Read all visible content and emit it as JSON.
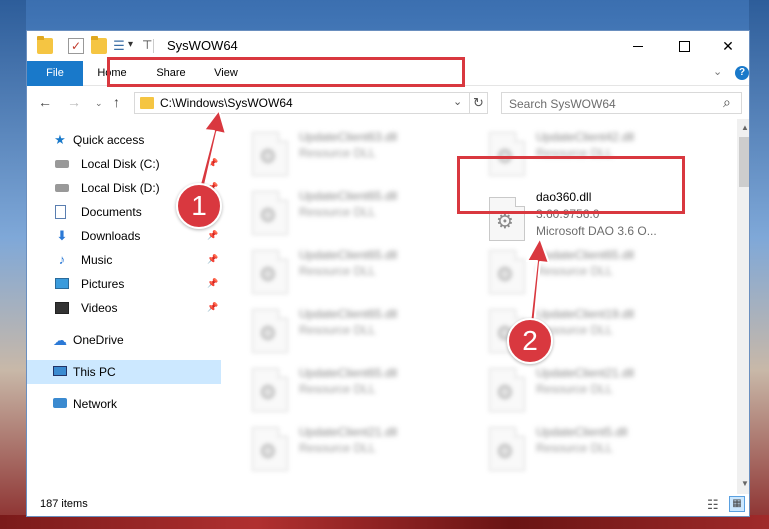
{
  "window": {
    "title": "SysWOW64",
    "controls": {
      "minimize": "",
      "maximize": "",
      "close": "✕"
    }
  },
  "ribbon": {
    "tabs": [
      "File",
      "Home",
      "Share",
      "View"
    ],
    "chevron": "⌄",
    "help": "?"
  },
  "nav": {
    "back": "←",
    "forward": "→",
    "recent": "⌄",
    "up": "↑",
    "address": "C:\\Windows\\SysWOW64",
    "address_dropdown": "⌄",
    "refresh": "↻",
    "search_placeholder": "Search SysWOW64"
  },
  "sidebar": {
    "items": [
      {
        "label": "Quick access",
        "icon": "star-icon",
        "pinned": false
      },
      {
        "label": "Local Disk (C:)",
        "icon": "drive-icon",
        "pinned": true
      },
      {
        "label": "Local Disk (D:)",
        "icon": "drive-icon",
        "pinned": true
      },
      {
        "label": "Documents",
        "icon": "documents-icon",
        "pinned": true
      },
      {
        "label": "Downloads",
        "icon": "downloads-icon",
        "pinned": true
      },
      {
        "label": "Music",
        "icon": "music-icon",
        "pinned": true
      },
      {
        "label": "Pictures",
        "icon": "pictures-icon",
        "pinned": true
      },
      {
        "label": "Videos",
        "icon": "videos-icon",
        "pinned": true
      },
      {
        "label": "OneDrive",
        "icon": "onedrive-icon",
        "pinned": false
      },
      {
        "label": "This PC",
        "icon": "this-pc-icon",
        "pinned": false,
        "selected": true
      },
      {
        "label": "Network",
        "icon": "network-icon",
        "pinned": false
      }
    ]
  },
  "files": [
    {
      "name": "UpdateClient63.dll",
      "type": "Resource DLL",
      "blurred": true
    },
    {
      "name": "UpdateClient42.dll",
      "type": "Resource DLL",
      "blurred": true
    },
    {
      "name": "UpdateClient65.dll",
      "type": "Resource DLL",
      "blurred": true
    },
    {
      "name": "dao360.dll",
      "type": "3.60.9756.0",
      "desc": "Microsoft DAO 3.6 O...",
      "blurred": false,
      "highlighted": true
    },
    {
      "name": "UpdateClient65.dll",
      "type": "Resource DLL",
      "blurred": true
    },
    {
      "name": "UpdateClient65.dll",
      "type": "Resource DLL",
      "blurred": true
    },
    {
      "name": "UpdateClient65.dll",
      "type": "Resource DLL",
      "blurred": true
    },
    {
      "name": "UpdateClient19.dll",
      "type": "Resource DLL",
      "blurred": true
    },
    {
      "name": "UpdateClient65.dll",
      "type": "Resource DLL",
      "blurred": true
    },
    {
      "name": "UpdateClient21.dll",
      "type": "Resource DLL",
      "blurred": true
    },
    {
      "name": "UpdateClient21.dll",
      "type": "Resource DLL",
      "blurred": true
    },
    {
      "name": "UpdateClient5.dll",
      "type": "Resource DLL",
      "blurred": true
    }
  ],
  "status": {
    "item_count": "187 items"
  },
  "annotations": {
    "step1": "1",
    "step2": "2",
    "color": "#d9383f"
  }
}
